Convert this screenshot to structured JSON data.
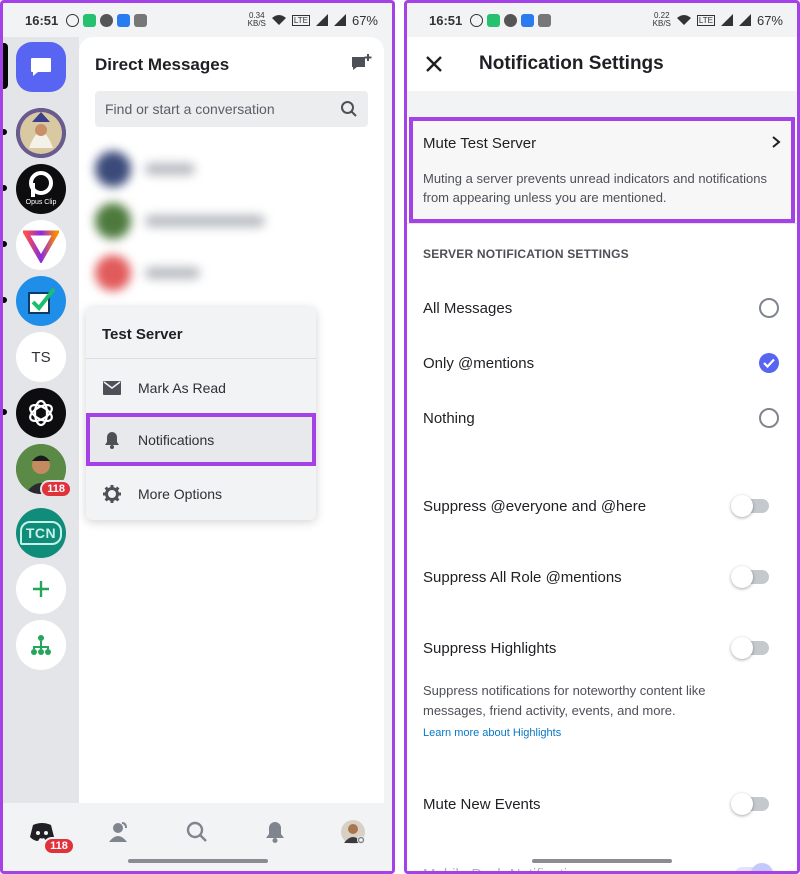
{
  "left_phone": {
    "status": {
      "time": "16:51",
      "speed": "0.34",
      "speed_unit": "KB/S",
      "battery": "67%"
    },
    "rail": {
      "items": [
        {
          "name": "direct-messages"
        },
        {
          "name": "server-wizard"
        },
        {
          "name": "server-opus-clip",
          "label": "Opus Clip"
        },
        {
          "name": "server-triangle"
        },
        {
          "name": "server-checkbox"
        },
        {
          "name": "server-test",
          "label": "TS"
        },
        {
          "name": "server-openai"
        },
        {
          "name": "server-avatar",
          "badge": "118"
        },
        {
          "name": "server-tcn",
          "label": "TCN"
        },
        {
          "name": "add-server"
        },
        {
          "name": "discover-servers"
        }
      ]
    },
    "dm": {
      "title": "Direct Messages",
      "search_placeholder": "Find or start a conversation"
    },
    "context_menu": {
      "title": "Test Server",
      "items": [
        {
          "label": "Mark As Read",
          "icon": "envelope-icon"
        },
        {
          "label": "Notifications",
          "icon": "bell-icon"
        },
        {
          "label": "More Options",
          "icon": "gear-icon"
        }
      ]
    },
    "bottom_nav": {
      "home_badge": "118"
    },
    "colors": {
      "highlight": "#a442e8",
      "blurple": "#5865f2",
      "badge_red": "#e0323b"
    }
  },
  "right_phone": {
    "status": {
      "time": "16:51",
      "speed": "0.22",
      "speed_unit": "KB/S",
      "battery": "67%"
    },
    "header": {
      "title": "Notification Settings"
    },
    "mute": {
      "title": "Mute Test Server",
      "description": "Muting a server prevents unread indicators and notifications from appearing unless you are mentioned."
    },
    "section_title": "SERVER NOTIFICATION SETTINGS",
    "options": [
      {
        "label": "All Messages",
        "checked": false
      },
      {
        "label": "Only @mentions",
        "checked": true
      },
      {
        "label": "Nothing",
        "checked": false
      }
    ],
    "toggles": [
      {
        "label": "Suppress @everyone and @here",
        "on": false
      },
      {
        "label": "Suppress All Role @mentions",
        "on": false
      },
      {
        "label": "Suppress Highlights",
        "on": false
      },
      {
        "label": "Mute New Events",
        "on": false
      },
      {
        "label": "Mobile Push Notifications",
        "on": true
      }
    ],
    "highlights_desc": "Suppress notifications for noteworthy content like messages, friend activity, events, and more.",
    "highlights_link": "Learn more about Highlights"
  }
}
